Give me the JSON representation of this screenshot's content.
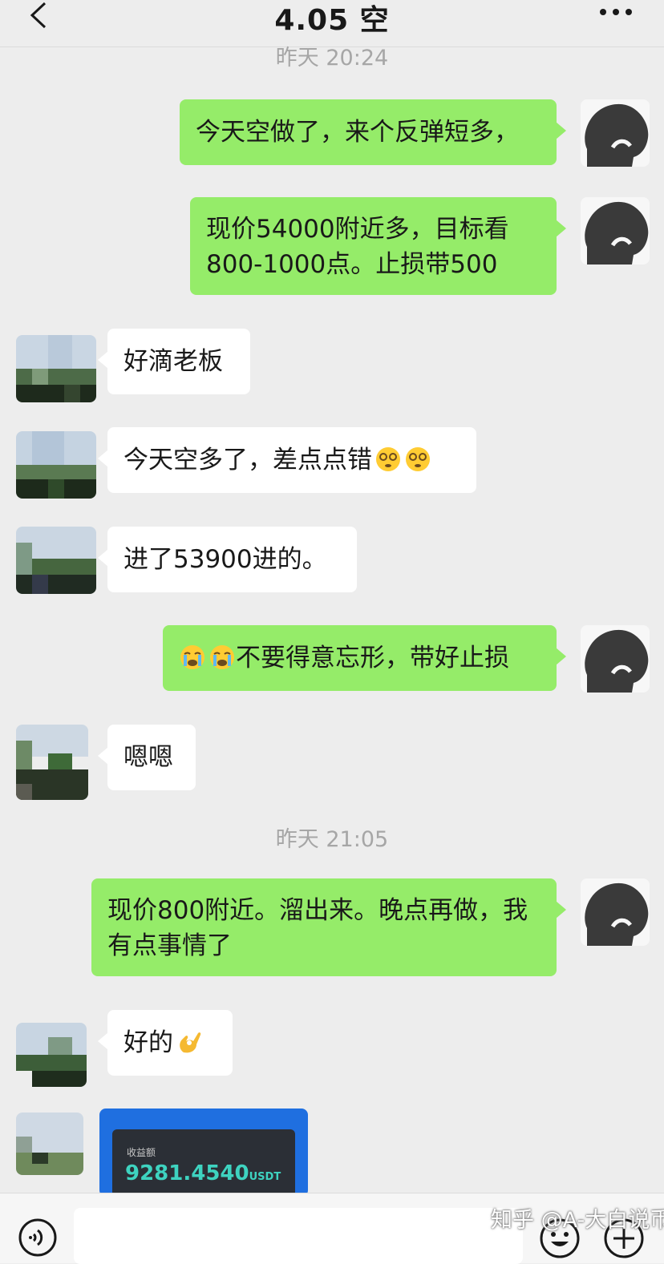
{
  "header": {
    "title": "4.05 空",
    "back_icon": "chevron-left-icon",
    "more_icon": "ellipsis-icon"
  },
  "timestamps": [
    "昨天 20:24",
    "昨天 21:05"
  ],
  "messages": [
    {
      "sender": "me",
      "text": "今天空做了，来个反弹短多，"
    },
    {
      "sender": "me",
      "text": "现价54000附近多，目标看800-1000点。止损带500"
    },
    {
      "sender": "peer",
      "text": "好滴老板"
    },
    {
      "sender": "peer",
      "text": "今天空多了，差点点错",
      "emoji": "dizzy-face-emoji x2"
    },
    {
      "sender": "peer",
      "text": "进了53900进的。"
    },
    {
      "sender": "me",
      "text": "不要得意忘形，带好止损",
      "emoji": "loudly-crying-face-emoji x2"
    },
    {
      "sender": "peer",
      "text": "嗯嗯"
    },
    {
      "sender": "me",
      "text": "现价800附近。溜出来。晚点再做，我有点事情了"
    },
    {
      "sender": "peer",
      "text": "好的",
      "emoji": "ok-hand-emoji"
    }
  ],
  "shared_card": {
    "label": "收益额",
    "value": "9281.4540",
    "unit": "USDT"
  },
  "input_bar": {
    "voice_icon": "voice-icon",
    "emoji_icon": "smiley-icon",
    "plus_icon": "plus-circle-icon"
  },
  "watermark": "知乎 @A-大白说币",
  "colors": {
    "my_bubble": "#95ec69",
    "peer_bubble": "#ffffff",
    "background": "#ededed",
    "card": "#1f6fe0"
  }
}
